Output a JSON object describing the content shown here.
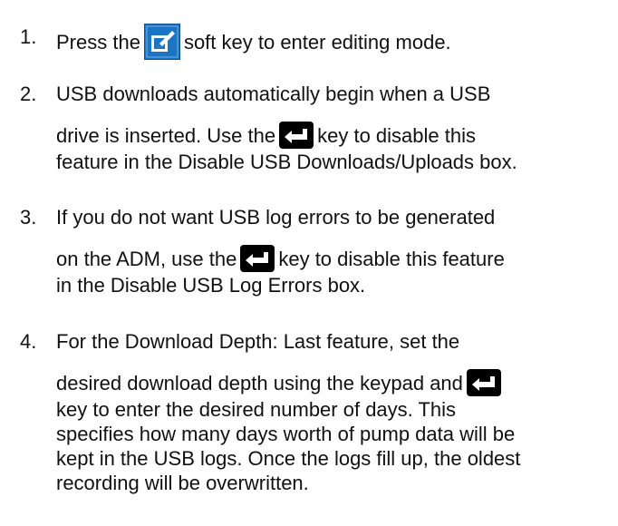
{
  "steps": [
    {
      "number": "1.",
      "before_icon": "Press the",
      "icon": "edit-soft-key-icon",
      "after_icon": "soft key to enter editing mode."
    },
    {
      "number": "2.",
      "line1": "USB downloads automatically begin when a USB",
      "line2_before": "drive is inserted. Use the",
      "icon": "enter-key-icon",
      "line2_after": "key to disable this",
      "line3": "feature in the Disable USB Downloads/Uploads box."
    },
    {
      "number": "3.",
      "line1": "If you do not want USB log errors to be generated",
      "line2_before": "on the ADM, use the",
      "icon": "enter-key-icon",
      "line2_after": "key to disable this feature",
      "line3": "in the Disable USB Log Errors box."
    },
    {
      "number": "4.",
      "line1": "For the Download Depth: Last feature, set the",
      "line2_before": "desired download depth using the keypad and",
      "icon": "enter-key-icon",
      "line3": "key to enter the desired number of days. This",
      "line4": "specifies how many days worth of pump data will be",
      "line5": "kept in the USB logs. Once the logs fill up, the oldest",
      "line6": "recording will be overwritten."
    }
  ],
  "colors": {
    "text": "#111111",
    "edit_icon_blue": "#1c74c4",
    "enter_key_black": "#000000"
  }
}
